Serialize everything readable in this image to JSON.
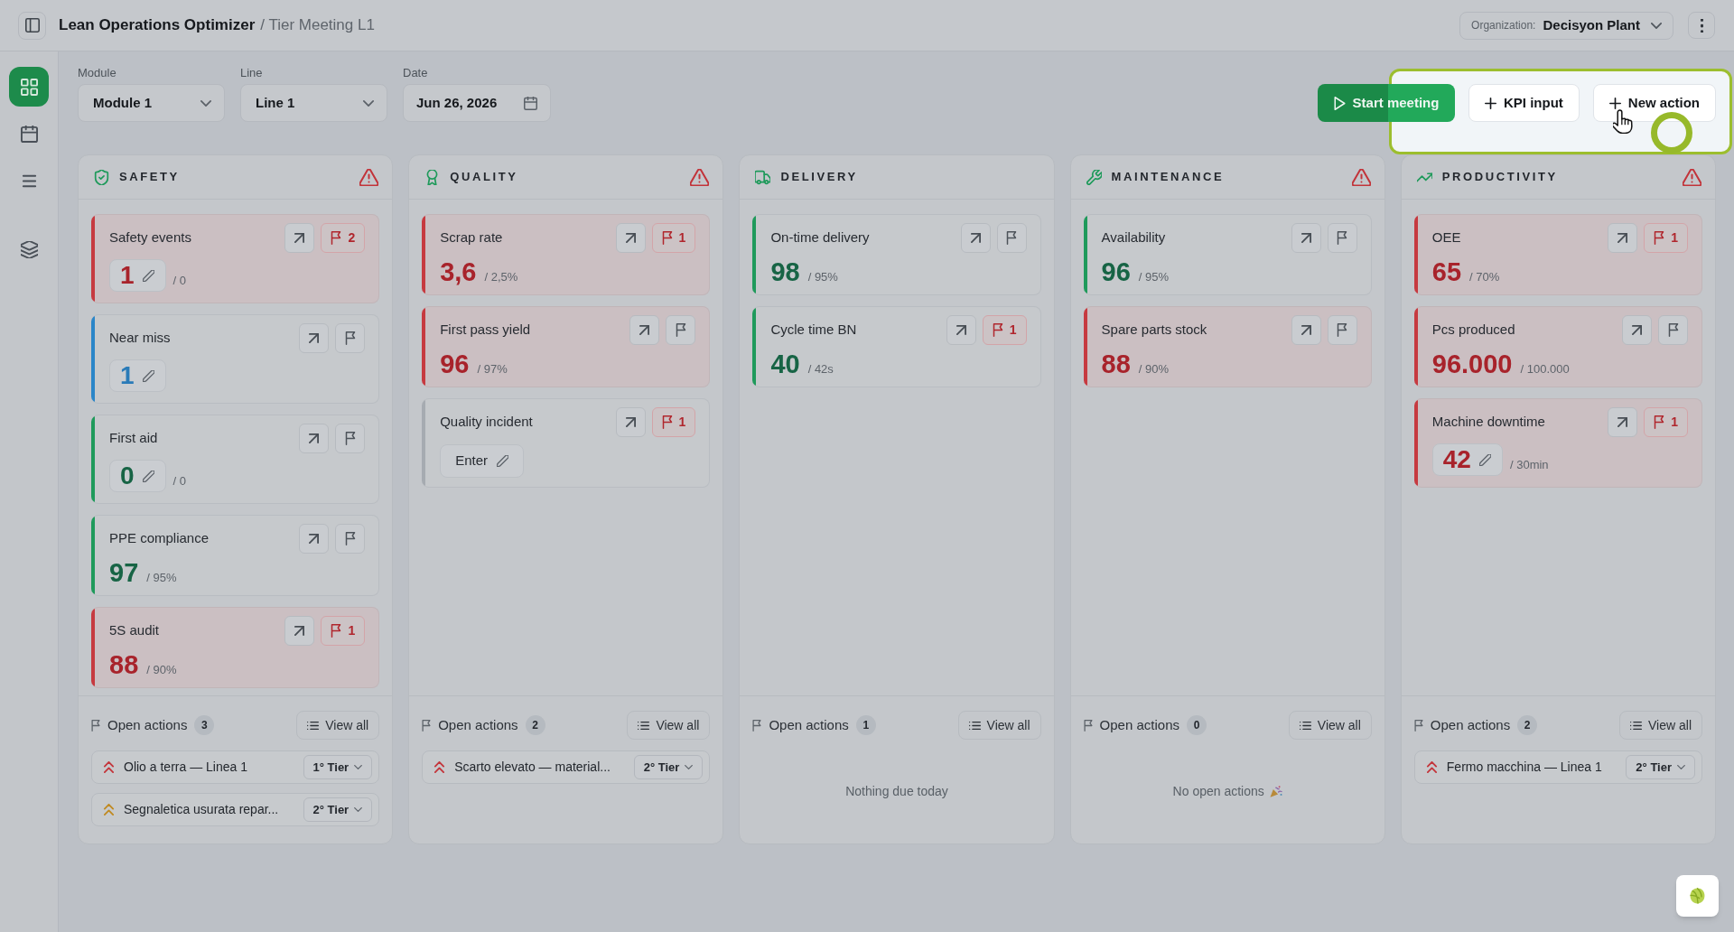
{
  "header": {
    "title": "Lean Operations Optimizer",
    "breadcrumb": "/ Tier Meeting L1",
    "organization_label": "Organization:",
    "organization": "Decisyon Plant"
  },
  "sidebar": {
    "items": [
      {
        "kind": "dashboard",
        "selected": true
      },
      {
        "kind": "calendar",
        "selected": false
      },
      {
        "kind": "list",
        "selected": false
      },
      {
        "kind": "layers",
        "selected": false
      }
    ]
  },
  "filters": [
    {
      "kind": "select",
      "label": "Module",
      "value": "Module 1"
    },
    {
      "kind": "select",
      "label": "Line",
      "value": "Line 1"
    },
    {
      "kind": "date",
      "label": "Date",
      "value": "Jun 26, 2026"
    }
  ],
  "toolbar": [
    {
      "kind": "start",
      "label": "Start meeting"
    },
    {
      "kind": "add",
      "label": "KPI input"
    },
    {
      "kind": "add",
      "label": "New action"
    }
  ],
  "columns": [
    {
      "kind": "safety",
      "title": "SAFETY",
      "alert": true,
      "kpis": [
        {
          "name": "Safety events",
          "color": "#c63a40",
          "kind": "manual",
          "value": "1",
          "target": "/ 0",
          "flag_count": "2"
        },
        {
          "name": "Near miss",
          "color": "#2b86c8",
          "kind": "manual",
          "value": "1"
        },
        {
          "name": "First aid",
          "color": "#1f9a5b",
          "kind": "manual",
          "value": "0",
          "target": "/ 0"
        },
        {
          "name": "PPE compliance",
          "color": "#1f9a5b",
          "kind": "auto",
          "value": "97",
          "target": "/ 95%"
        },
        {
          "name": "5S audit",
          "color": "#c63a40",
          "kind": "auto",
          "value": "88",
          "target": "/ 90%",
          "flag_count": "1"
        }
      ],
      "open_actions": {
        "label": "Open actions",
        "count": "3",
        "view_all": "View all",
        "items": [
          {
            "title": "Olio a terra — Linea 1",
            "color": "#c3363c",
            "tier": "1° Tier"
          },
          {
            "title": "Segnaletica usurata repar...",
            "color": "#c08a22",
            "tier": "2° Tier"
          }
        ]
      }
    },
    {
      "kind": "quality",
      "title": "QUALITY",
      "alert": true,
      "kpis": [
        {
          "name": "Scrap rate",
          "color": "#c63a40",
          "kind": "auto",
          "value": "3,6",
          "target": "/ 2,5%",
          "flag_count": "1"
        },
        {
          "name": "First pass yield",
          "color": "#c63a40",
          "kind": "auto",
          "value": "96",
          "target": "/ 97%"
        },
        {
          "name": "Quality incident",
          "color": "#a6abb1",
          "kind": "entry",
          "entry_label": "Enter",
          "flag_count": "1"
        }
      ],
      "open_actions": {
        "label": "Open actions",
        "count": "2",
        "view_all": "View all",
        "items": [
          {
            "title": "Scarto elevato — material...",
            "color": "#c3363c",
            "tier": "2° Tier"
          }
        ]
      }
    },
    {
      "kind": "delivery",
      "title": "DELIVERY",
      "alert": false,
      "kpis": [
        {
          "name": "On-time delivery",
          "color": "#1f9a5b",
          "kind": "auto",
          "value": "98",
          "target": "/ 95%"
        },
        {
          "name": "Cycle time BN",
          "color": "#1f9a5b",
          "kind": "auto",
          "value": "40",
          "target": "/ 42s",
          "flag_count": "1"
        }
      ],
      "open_actions": {
        "label": "Open actions",
        "count": "1",
        "view_all": "View all",
        "empty": {
          "text": "Nothing due today",
          "celebration": false
        }
      }
    },
    {
      "kind": "maintenance",
      "title": "MAINTENANCE",
      "alert": true,
      "kpis": [
        {
          "name": "Availability",
          "color": "#1f9a5b",
          "kind": "auto",
          "value": "96",
          "target": "/ 95%"
        },
        {
          "name": "Spare parts stock",
          "color": "#c63a40",
          "kind": "auto",
          "value": "88",
          "target": "/ 90%"
        }
      ],
      "open_actions": {
        "label": "Open actions",
        "count": "0",
        "view_all": "View all",
        "empty": {
          "text": "No open actions",
          "celebration": true
        }
      }
    },
    {
      "kind": "productivity",
      "title": "PRODUCTIVITY",
      "alert": true,
      "kpis": [
        {
          "name": "OEE",
          "color": "#c63a40",
          "kind": "auto",
          "value": "65",
          "target": "/ 70%",
          "flag_count": "1"
        },
        {
          "name": "Pcs produced",
          "color": "#c63a40",
          "kind": "auto",
          "value": "96.000",
          "target": "/ 100.000"
        },
        {
          "name": "Machine downtime",
          "color": "#c63a40",
          "kind": "manual",
          "value": "42",
          "target": "/ 30min",
          "flag_count": "1"
        }
      ],
      "open_actions": {
        "label": "Open actions",
        "count": "2",
        "view_all": "View all",
        "items": [
          {
            "title": "Fermo macchina — Linea 1",
            "color": "#c3363c",
            "tier": "2° Tier"
          }
        ]
      }
    }
  ]
}
